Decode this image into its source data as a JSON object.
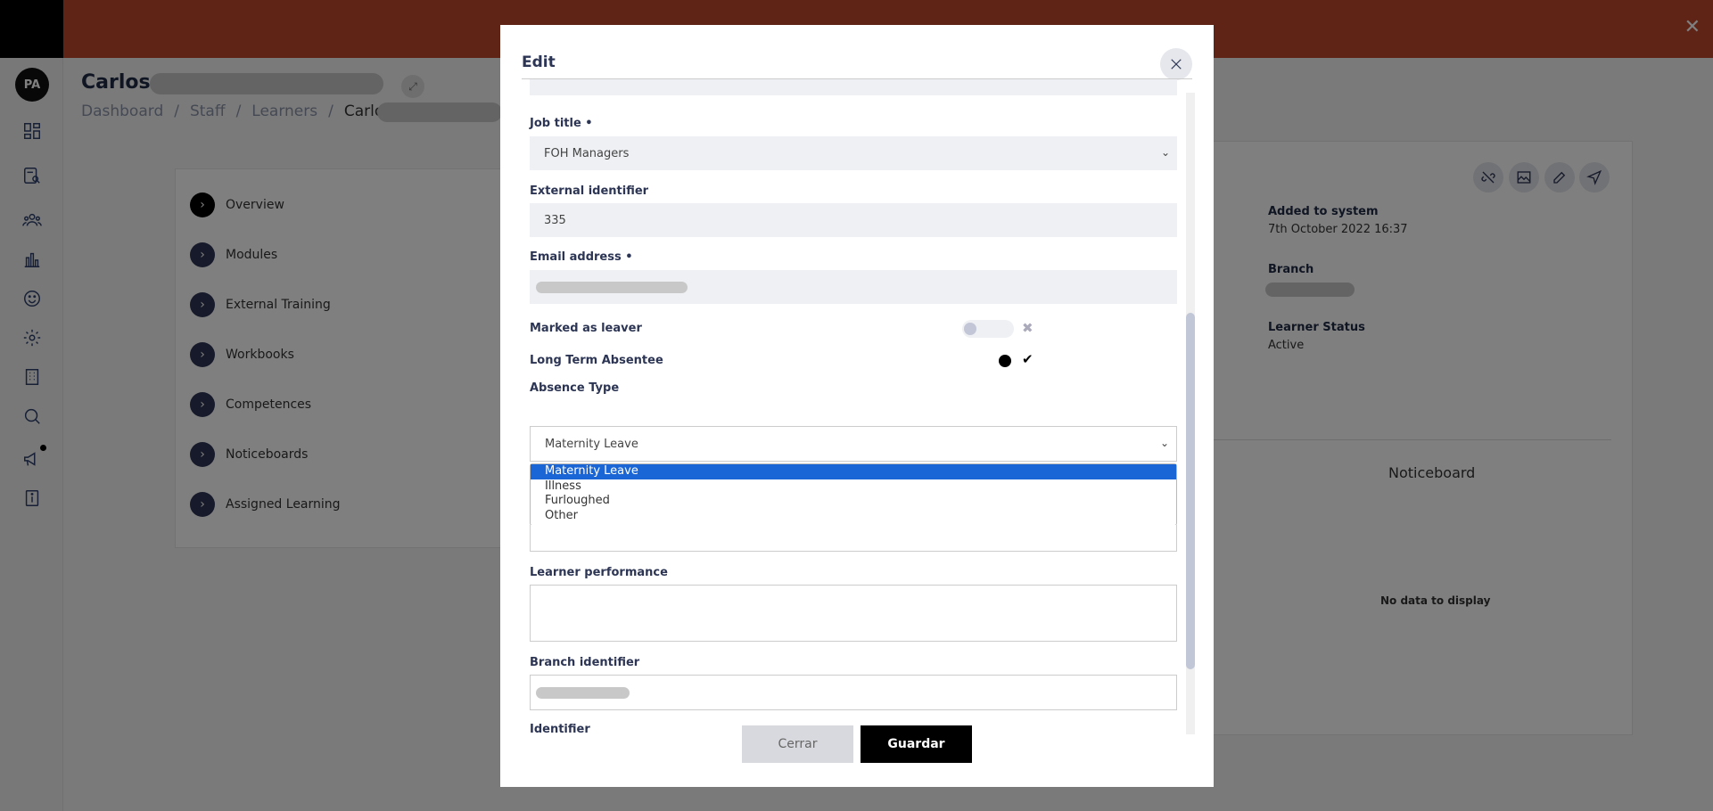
{
  "sidebar": {
    "avatar_initials": "PA",
    "icons": [
      "dashboard-icon",
      "search-doc-icon",
      "users-icon",
      "chart-icon",
      "smiley-icon",
      "gear-icon",
      "building-icon",
      "search-icon",
      "megaphone-icon",
      "info-icon"
    ]
  },
  "page": {
    "title": "Carlos",
    "breadcrumb": [
      "Dashboard",
      "Staff",
      "Learners",
      "Carlos"
    ],
    "breadcrumb_sep": "/"
  },
  "side_menu": [
    {
      "label": "Overview"
    },
    {
      "label": "Modules"
    },
    {
      "label": "External Training"
    },
    {
      "label": "Workbooks"
    },
    {
      "label": "Competences"
    },
    {
      "label": "Noticeboards"
    },
    {
      "label": "Assigned Learning"
    }
  ],
  "profile": {
    "added_label": "Added to system",
    "added_value": "7th October 2022 16:37",
    "branch_label": "Branch",
    "status_label": "Learner Status",
    "status_value": "Active",
    "noticeboard_title": "Noticeboard",
    "no_data": "No data to display"
  },
  "modal": {
    "title": "Edit",
    "job_title_label": "Job title",
    "job_title_value": "FOH Managers",
    "external_id_label": "External identifier",
    "external_id_value": "335",
    "email_label": "Email address",
    "required_mark": "•",
    "leaver_label": "Marked as leaver",
    "absentee_label": "Long Term Absentee",
    "absence_type_label": "Absence Type",
    "absence_type_value": "Maternity Leave",
    "absence_options": [
      "Maternity Leave",
      "Illness",
      "Furloughed",
      "Other"
    ],
    "performance_label": "Learner performance",
    "branch_id_label": "Branch identifier",
    "identifier_label": "Identifier",
    "cancel_label": "Cerrar",
    "save_label": "Guardar"
  },
  "colors": {
    "banner": "#c0482f",
    "selected_option": "#1a66d6",
    "primary_button": "#000000"
  }
}
